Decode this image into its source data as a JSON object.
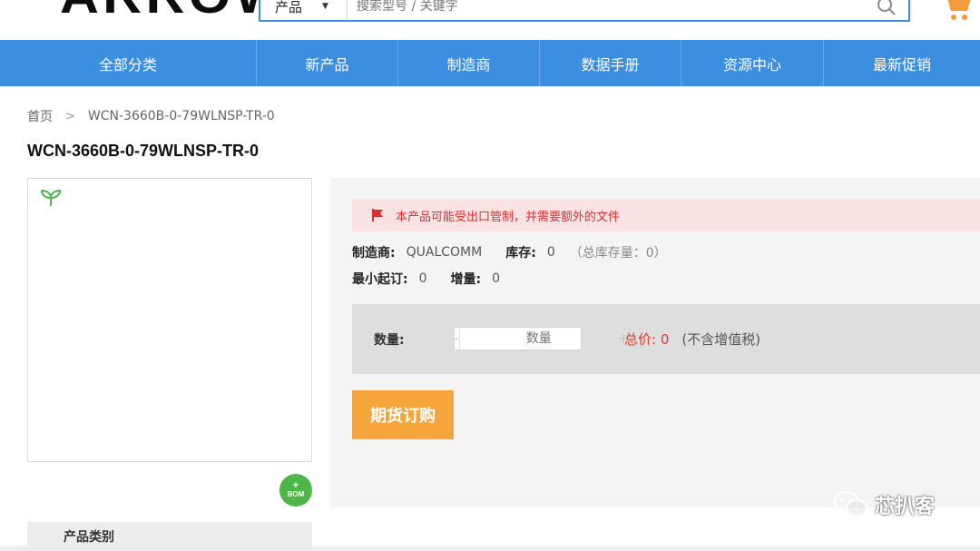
{
  "header": {
    "logo_text": "ARROW",
    "search": {
      "category": "产品",
      "placeholder": "搜索型号 / 关键字"
    }
  },
  "nav": {
    "items": [
      "全部分类",
      "新产品",
      "制造商",
      "数据手册",
      "资源中心",
      "最新促销"
    ]
  },
  "breadcrumb": {
    "home": "首页",
    "current": "WCN-3660B-0-79WLNSP-TR-0"
  },
  "product": {
    "title": "WCN-3660B-0-79WLNSP-TR-0",
    "export_warning": "本产品可能受出口管制，并需要额外的文件",
    "manufacturer_label": "制造商:",
    "manufacturer": "QUALCOMM",
    "stock_label": "库存:",
    "stock": "0",
    "total_stock": "（总库存量：0）",
    "moq_label": "最小起订:",
    "moq": "0",
    "increment_label": "增量:",
    "increment": "0"
  },
  "order": {
    "qty_label": "数量:",
    "qty_placeholder": "数量",
    "minus": "-",
    "plus": "+",
    "total_price": "总价: 0",
    "tax_note": "(不含增值税)",
    "button_label": "期货订购"
  },
  "bom": {
    "plus": "+",
    "label": "BOM"
  },
  "sidebar": {
    "category_title": "产品类别"
  },
  "watermark": {
    "text": "芯扒客"
  },
  "colors": {
    "nav_blue": "#3c8ee0",
    "warning_red": "#d92f2f",
    "order_orange": "#f5a53a",
    "bom_green": "#4cb648"
  }
}
